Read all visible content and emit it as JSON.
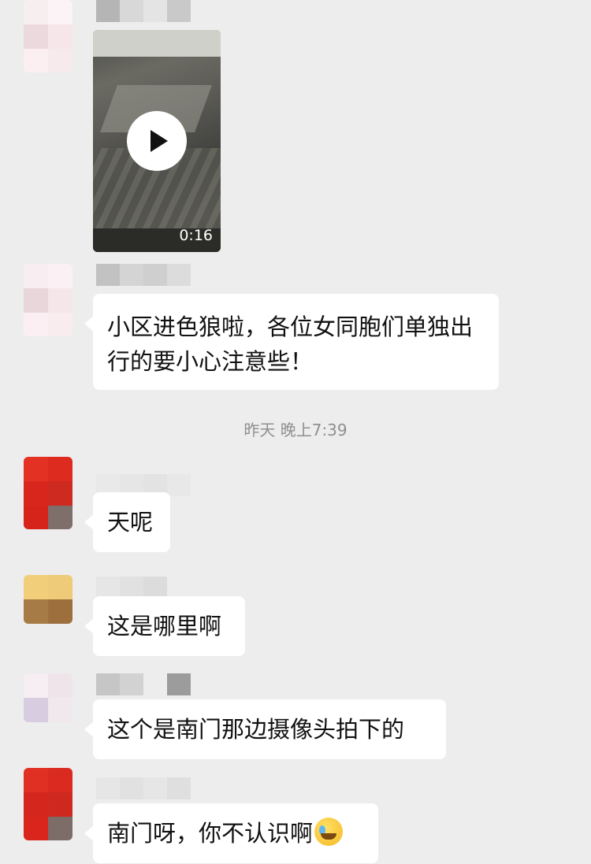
{
  "video": {
    "duration": "0:16",
    "play_icon": "play-icon"
  },
  "messages": [
    {
      "text": "小区进色狼啦，各位女同胞们单独出行的要小心注意些！"
    },
    {
      "text": "天呢"
    },
    {
      "text": "这是哪里啊"
    },
    {
      "text": "这个是南门那边摄像头拍下的"
    },
    {
      "text": "南门呀，你不认识啊",
      "emoji": "laughing-crying-emoji"
    }
  ],
  "timestamp": "昨天 晚上7:39",
  "colors": {
    "background": "#ededed",
    "bubble": "#ffffff",
    "timestamp_text": "#8f8f8f",
    "avatar_red": "#d9261c"
  }
}
